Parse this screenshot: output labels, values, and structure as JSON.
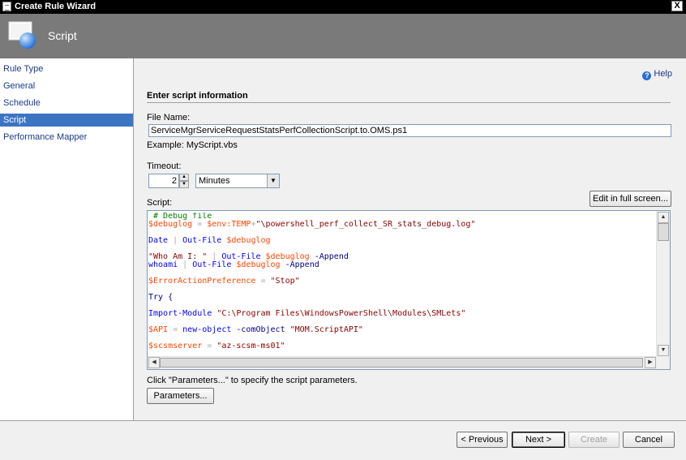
{
  "window": {
    "title": "Create Rule Wizard",
    "close_label": "X"
  },
  "header": {
    "title": "Script",
    "icon": "wizard-monitor-icon"
  },
  "sidebar": {
    "items": [
      {
        "label": "Rule Type",
        "active": false
      },
      {
        "label": "General",
        "active": false
      },
      {
        "label": "Schedule",
        "active": false
      },
      {
        "label": "Script",
        "active": true
      },
      {
        "label": "Performance Mapper",
        "active": false
      }
    ]
  },
  "main": {
    "help_label": "Help",
    "section_title": "Enter script information",
    "file_name_label": "File Name:",
    "file_name_value": "ServiceMgrServiceRequestStatsPerfCollectionScript.to.OMS.ps1",
    "example_text": "Example:  MyScript.vbs",
    "timeout_label": "Timeout:",
    "timeout_value": "2",
    "timeout_unit": "Minutes",
    "script_label": "Script:",
    "edit_fullscreen_label": "Edit in full screen...",
    "parameters_hint": "Click \"Parameters...\" to specify the script parameters.",
    "parameters_button": "Parameters..."
  },
  "script_lines": [
    [
      {
        "t": " # Debug file",
        "c": "comment"
      }
    ],
    [
      {
        "t": "$debuglog",
        "c": "var"
      },
      {
        "t": " = ",
        "c": "op"
      },
      {
        "t": "$env:TEMP",
        "c": "var"
      },
      {
        "t": "+",
        "c": "op"
      },
      {
        "t": "\"\\powershell_perf_collect_SR_stats_debug.log\"",
        "c": "str"
      }
    ],
    [],
    [
      {
        "t": "Date",
        "c": "cmd"
      },
      {
        "t": " | ",
        "c": "op"
      },
      {
        "t": "Out-File",
        "c": "cmd"
      },
      {
        "t": " ",
        "c": "plain"
      },
      {
        "t": "$debuglog",
        "c": "var"
      }
    ],
    [],
    [
      {
        "t": "\"Who Am I: \"",
        "c": "str"
      },
      {
        "t": " | ",
        "c": "op"
      },
      {
        "t": "Out-File",
        "c": "cmd"
      },
      {
        "t": " ",
        "c": "plain"
      },
      {
        "t": "$debuglog",
        "c": "var"
      },
      {
        "t": " -Append",
        "c": "param"
      }
    ],
    [
      {
        "t": "whoami",
        "c": "cmd"
      },
      {
        "t": " | ",
        "c": "op"
      },
      {
        "t": "Out-File",
        "c": "cmd"
      },
      {
        "t": " ",
        "c": "plain"
      },
      {
        "t": "$debuglog",
        "c": "var"
      },
      {
        "t": " -Append",
        "c": "param"
      }
    ],
    [],
    [
      {
        "t": "$ErrorActionPreference",
        "c": "var"
      },
      {
        "t": " = ",
        "c": "op"
      },
      {
        "t": "\"Stop\"",
        "c": "str"
      }
    ],
    [],
    [
      {
        "t": "Try {",
        "c": "param"
      }
    ],
    [],
    [
      {
        "t": "Import-Module",
        "c": "cmd"
      },
      {
        "t": " ",
        "c": "plain"
      },
      {
        "t": "\"C:\\Program Files\\WindowsPowerShell\\Modules\\SMLets\"",
        "c": "str"
      }
    ],
    [],
    [
      {
        "t": "$API",
        "c": "var"
      },
      {
        "t": " = ",
        "c": "op"
      },
      {
        "t": "new-object",
        "c": "cmd"
      },
      {
        "t": " -comObject",
        "c": "param"
      },
      {
        "t": " ",
        "c": "plain"
      },
      {
        "t": "\"MOM.ScriptAPI\"",
        "c": "str"
      }
    ],
    [],
    [
      {
        "t": "$scsmserver",
        "c": "var"
      },
      {
        "t": " = ",
        "c": "op"
      },
      {
        "t": "\"az-scsm-ms01\"",
        "c": "str"
      }
    ]
  ],
  "footer": {
    "previous": "< Previous",
    "next": "Next >",
    "create": "Create",
    "cancel": "Cancel"
  },
  "colors": {
    "header_bg": "#7a7a7a",
    "nav_active": "#3c74c4",
    "comment": "#008000",
    "variable": "#ff4500",
    "string": "#8b0000",
    "command": "#0000ff"
  }
}
